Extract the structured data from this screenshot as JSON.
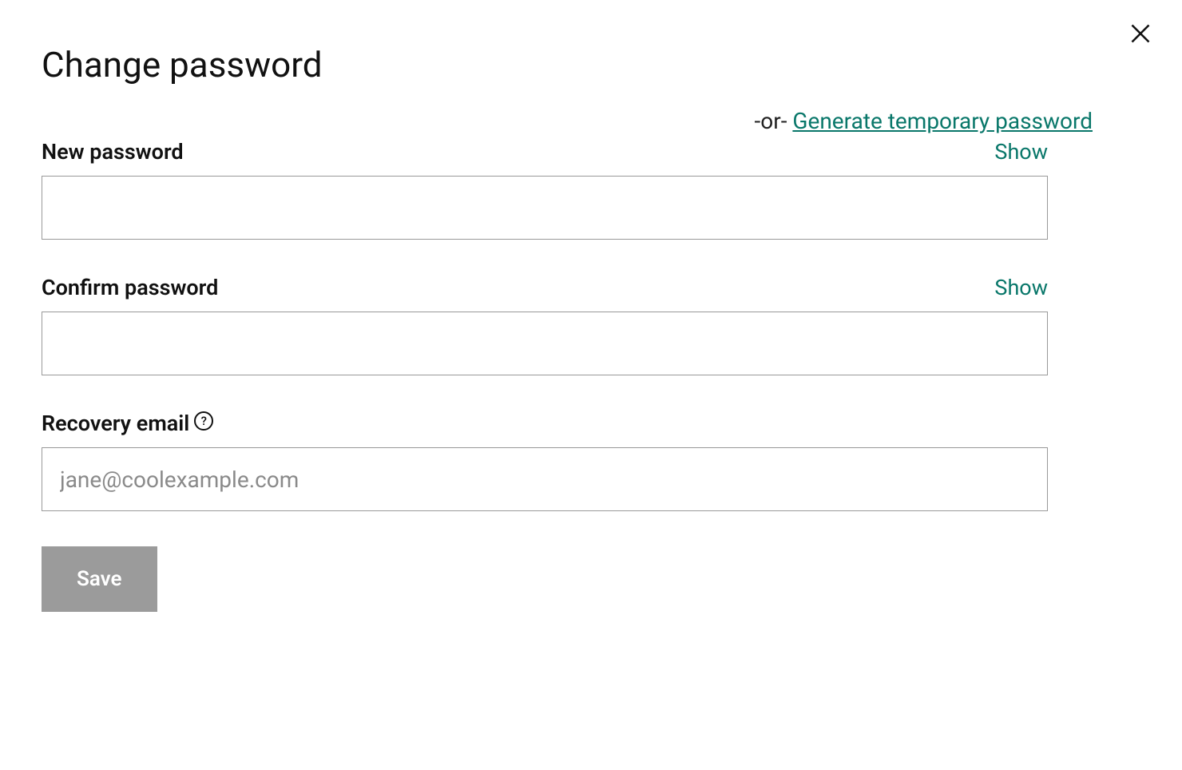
{
  "modal": {
    "title": "Change password",
    "or_text": "-or- ",
    "generate_link": "Generate temporary password",
    "close_label": "Close"
  },
  "fields": {
    "new_password": {
      "label": "New password",
      "show": "Show",
      "value": ""
    },
    "confirm_password": {
      "label": "Confirm password",
      "show": "Show",
      "value": ""
    },
    "recovery_email": {
      "label": "Recovery email",
      "placeholder": "jane@coolexample.com",
      "value": "",
      "help": "?"
    }
  },
  "actions": {
    "save": "Save"
  }
}
